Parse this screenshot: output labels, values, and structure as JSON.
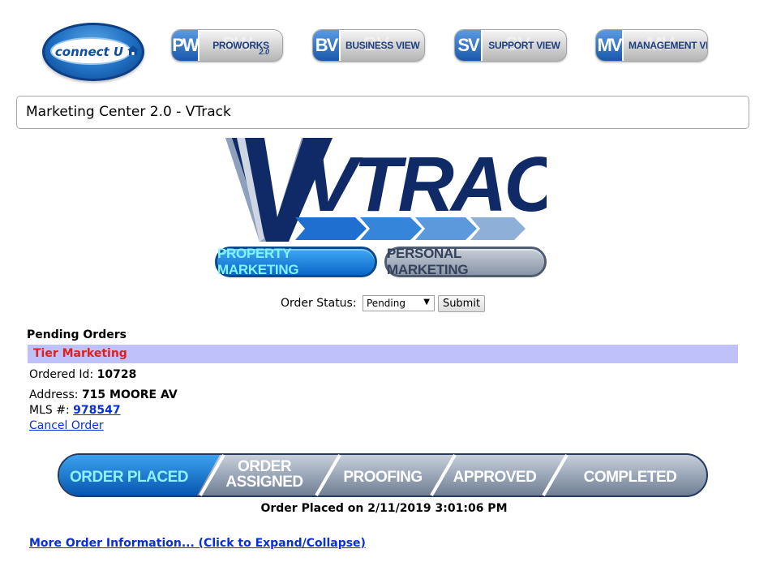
{
  "nav": {
    "logo_text": "connect U",
    "buttons": [
      {
        "abbr": "PW",
        "label": "PROWORKS",
        "sub": "2.0"
      },
      {
        "abbr": "BV",
        "label": "BUSINESS VIEW"
      },
      {
        "abbr": "SV",
        "label": "SUPPORT VIEW"
      },
      {
        "abbr": "MV",
        "label": "MANAGEMENT VIEW"
      }
    ]
  },
  "page_title": "Marketing Center 2.0 - VTrack",
  "brand": {
    "logo_text": "VTRACK",
    "tabs": [
      "PROPERTY MARKETING",
      "PERSONAL MARKETING"
    ]
  },
  "status_form": {
    "label": "Order Status:",
    "selected": "Pending",
    "submit_label": "Submit"
  },
  "pending": {
    "title": "Pending Orders",
    "group_label": "Tier Marketing",
    "order_id_label": "Ordered Id:",
    "order_id": "10728",
    "address_label": "Address:",
    "address": "715 MOORE AV",
    "mls_label": "MLS #:",
    "mls": "978547",
    "cancel_label": "Cancel Order"
  },
  "progress": {
    "steps": [
      "ORDER PLACED",
      "ORDER ASSIGNED",
      "PROOFING",
      "APPROVED",
      "COMPLETED"
    ],
    "active_index": 0,
    "placed_text": "Order Placed on 2/11/2019 3:01:06 PM"
  },
  "more_info_label": "More Order Information... (Click to Expand/Collapse)",
  "colors": {
    "tier_bar_bg": "#bfc1fb",
    "tier_text": "#e01f1f",
    "link": "#0b2fd6",
    "brand_navy": "#0f2a66",
    "active_step": "#0b74d1"
  }
}
